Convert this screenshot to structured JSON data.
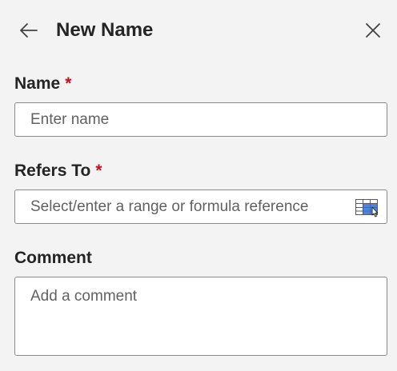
{
  "panel": {
    "title": "New Name",
    "back_icon": "arrow-left-icon",
    "close_icon": "close-icon"
  },
  "form": {
    "name": {
      "label": "Name",
      "required_marker": "*",
      "placeholder": "Enter name",
      "value": ""
    },
    "refers_to": {
      "label": "Refers To",
      "required_marker": "*",
      "placeholder": "Select/enter a range or formula reference",
      "value": "",
      "picker_icon": "range-select-icon"
    },
    "comment": {
      "label": "Comment",
      "placeholder": "Add a comment",
      "value": ""
    }
  },
  "colors": {
    "background": "#f3f3f3",
    "required": "#c50f1f",
    "border": "#8a8a8a",
    "picker_accent": "#2f6fd6"
  }
}
